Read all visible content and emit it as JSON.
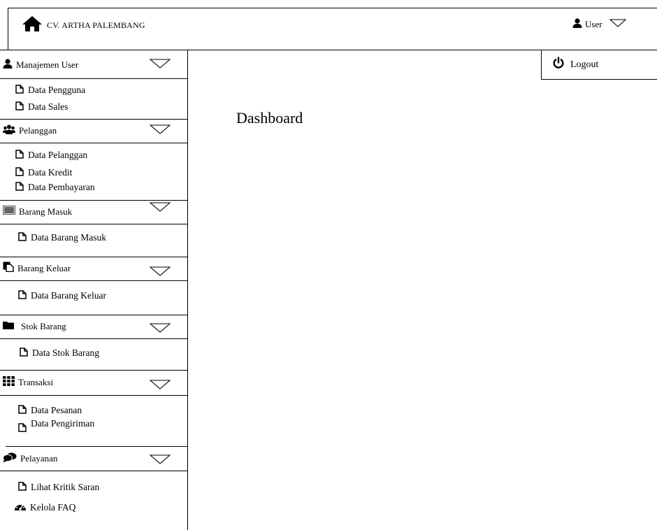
{
  "header": {
    "brand": "CV. ARTHA PALEMBANG",
    "user_label": "User"
  },
  "user_dropdown": {
    "logout_label": "Logout"
  },
  "main": {
    "page_title": "Dashboard"
  },
  "sidebar": {
    "sections": [
      {
        "label": "Manajemen User",
        "icon": "user-icon",
        "items": [
          "Data Pengguna",
          "Data Sales"
        ]
      },
      {
        "label": "Pelanggan",
        "icon": "users-icon",
        "items": [
          "Data Pelanggan",
          "Data Kredit",
          "Data Pembayaran"
        ]
      },
      {
        "label": "Barang Masuk",
        "icon": "list-icon",
        "items": [
          "Data Barang Masuk"
        ]
      },
      {
        "label": "Barang Keluar",
        "icon": "copy-icon",
        "items": [
          "Data Barang Keluar"
        ]
      },
      {
        "label": "Stok Barang",
        "icon": "folder-icon",
        "items": [
          "Data Stok Barang"
        ]
      },
      {
        "label": "Transaksi",
        "icon": "grid-icon",
        "items": [
          "Data Pesanan",
          "Data Pengiriman"
        ]
      },
      {
        "label": "Pelayanan",
        "icon": "comments-icon",
        "items": [
          "Lihat Kritik Saran",
          "Kelola FAQ"
        ]
      }
    ],
    "extra_icons": {
      "faq_item": "dashboard-gauge-icon"
    }
  }
}
